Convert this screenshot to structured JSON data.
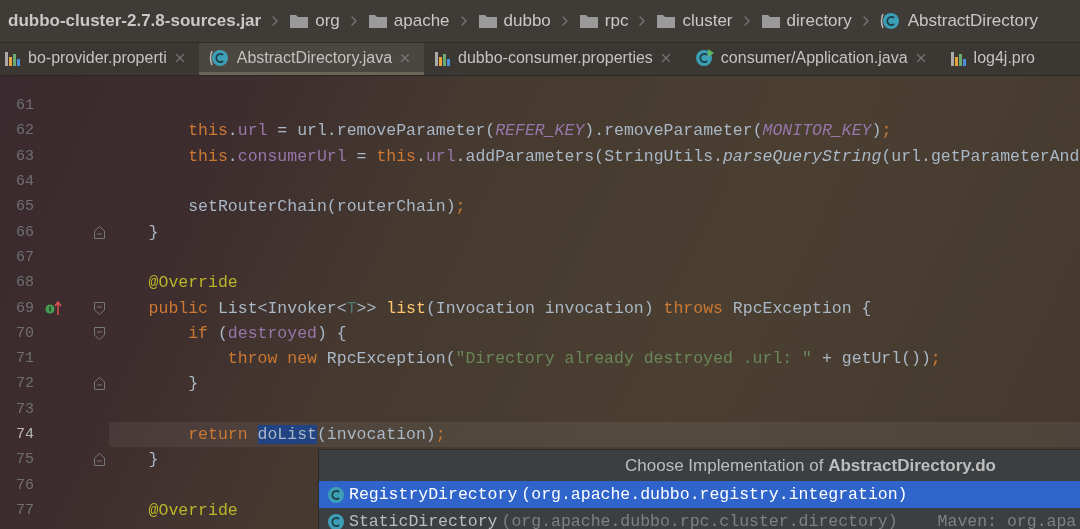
{
  "breadcrumb": [
    {
      "label": "dubbo-cluster-2.7.8-sources.jar",
      "kind": "jar"
    },
    {
      "label": "org",
      "kind": "folder"
    },
    {
      "label": "apache",
      "kind": "folder"
    },
    {
      "label": "dubbo",
      "kind": "folder"
    },
    {
      "label": "rpc",
      "kind": "folder"
    },
    {
      "label": "cluster",
      "kind": "folder"
    },
    {
      "label": "directory",
      "kind": "folder"
    },
    {
      "label": "AbstractDirectory",
      "kind": "class"
    }
  ],
  "tabs": [
    {
      "label": "bo-provider.properti",
      "kind": "properties",
      "selected": false,
      "closable": true
    },
    {
      "label": "AbstractDirectory.java",
      "kind": "class",
      "selected": true,
      "closable": true
    },
    {
      "label": "dubbo-consumer.properties",
      "kind": "properties",
      "selected": false,
      "closable": true
    },
    {
      "label": "consumer/Application.java",
      "kind": "runnable",
      "selected": false,
      "closable": true
    },
    {
      "label": "log4j.pro",
      "kind": "properties",
      "selected": false,
      "closable": false
    }
  ],
  "lines": [
    {
      "number": "61",
      "current": false
    },
    {
      "number": "62",
      "current": false,
      "tokens": [
        {
          "kind": "kw",
          "t": "        this"
        },
        {
          "kind": "plain",
          "t": "."
        },
        {
          "kind": "field",
          "t": "url"
        },
        {
          "kind": "plain",
          "t": " = url.removeParameter("
        },
        {
          "kind": "const",
          "t": "REFER_KEY"
        },
        {
          "kind": "plain",
          "t": ").removeParameter("
        },
        {
          "kind": "const",
          "t": "MONITOR_KEY"
        },
        {
          "kind": "plain",
          "t": ")"
        },
        {
          "kind": "semi",
          "t": ";"
        }
      ]
    },
    {
      "number": "63",
      "current": false,
      "tokens": [
        {
          "kind": "kw",
          "t": "        this"
        },
        {
          "kind": "plain",
          "t": "."
        },
        {
          "kind": "field",
          "t": "consumerUrl"
        },
        {
          "kind": "plain",
          "t": " = "
        },
        {
          "kind": "kw",
          "t": "this"
        },
        {
          "kind": "plain",
          "t": "."
        },
        {
          "kind": "field",
          "t": "url"
        },
        {
          "kind": "plain",
          "t": ".addParameters(StringUtils."
        },
        {
          "kind": "static",
          "t": "parseQueryString"
        },
        {
          "kind": "plain",
          "t": "(url.getParameterAnd"
        }
      ]
    },
    {
      "number": "64",
      "current": false
    },
    {
      "number": "65",
      "current": false,
      "tokens": [
        {
          "kind": "plain",
          "t": "        setRouterChain(routerChain)"
        },
        {
          "kind": "semi",
          "t": ";"
        }
      ]
    },
    {
      "number": "66",
      "fold": {
        "kind": "end"
      },
      "current": false,
      "tokens": [
        {
          "kind": "plain",
          "t": "    }"
        }
      ]
    },
    {
      "number": "67",
      "current": false
    },
    {
      "number": "68",
      "current": false,
      "tokens": [
        {
          "kind": "ann",
          "t": "    @Override"
        }
      ]
    },
    {
      "number": "69",
      "fold": {
        "kind": "start"
      },
      "marker": {
        "kind": "implements"
      },
      "current": false,
      "tokens": [
        {
          "kind": "kw",
          "t": "    public"
        },
        {
          "kind": "plain",
          "t": " List<Invoker<"
        },
        {
          "kind": "tparam",
          "t": "T"
        },
        {
          "kind": "plain",
          "t": ">> "
        },
        {
          "kind": "decl",
          "t": "list"
        },
        {
          "kind": "plain",
          "t": "(Invocation invocation) "
        },
        {
          "kind": "kw",
          "t": "throws"
        },
        {
          "kind": "plain",
          "t": " RpcException {"
        }
      ]
    },
    {
      "number": "70",
      "fold": {
        "kind": "start"
      },
      "current": false,
      "tokens": [
        {
          "kind": "kw",
          "t": "        if"
        },
        {
          "kind": "plain",
          "t": " ("
        },
        {
          "kind": "field",
          "t": "destroyed"
        },
        {
          "kind": "plain",
          "t": ") {"
        }
      ]
    },
    {
      "number": "71",
      "current": false,
      "tokens": [
        {
          "kind": "kw",
          "t": "            throw new"
        },
        {
          "kind": "plain",
          "t": " RpcException("
        },
        {
          "kind": "str",
          "t": "\"Directory already destroyed .url: \""
        },
        {
          "kind": "plain",
          "t": " + getUrl())"
        },
        {
          "kind": "semi",
          "t": ";"
        }
      ]
    },
    {
      "number": "72",
      "fold": {
        "kind": "end"
      },
      "current": false,
      "tokens": [
        {
          "kind": "plain",
          "t": "        }"
        }
      ]
    },
    {
      "number": "73",
      "current": false
    },
    {
      "number": "74",
      "current": true,
      "tokens": [
        {
          "kind": "kw",
          "t": "        return "
        },
        {
          "kind": "usage",
          "t": "doList"
        },
        {
          "kind": "plain",
          "t": "(invocation)"
        },
        {
          "kind": "semi",
          "t": ";"
        }
      ]
    },
    {
      "number": "75",
      "fold": {
        "kind": "end"
      },
      "current": false,
      "tokens": [
        {
          "kind": "plain",
          "t": "    }"
        }
      ]
    },
    {
      "number": "76",
      "current": false
    },
    {
      "number": "77",
      "current": false,
      "tokens": [
        {
          "kind": "ann",
          "t": "    @Override"
        }
      ]
    }
  ],
  "popup": {
    "title": "Choose Implementation of **AbstractDirectory.do**",
    "items": [
      {
        "name": "RegistryDirectory",
        "package": " (org.apache.dubbo.registry.integration)",
        "selected": true
      },
      {
        "name": "StaticDirectory",
        "package": " (org.apache.dubbo.rpc.cluster.directory)",
        "library": "Maven: org.apa",
        "selected": false
      }
    ]
  }
}
